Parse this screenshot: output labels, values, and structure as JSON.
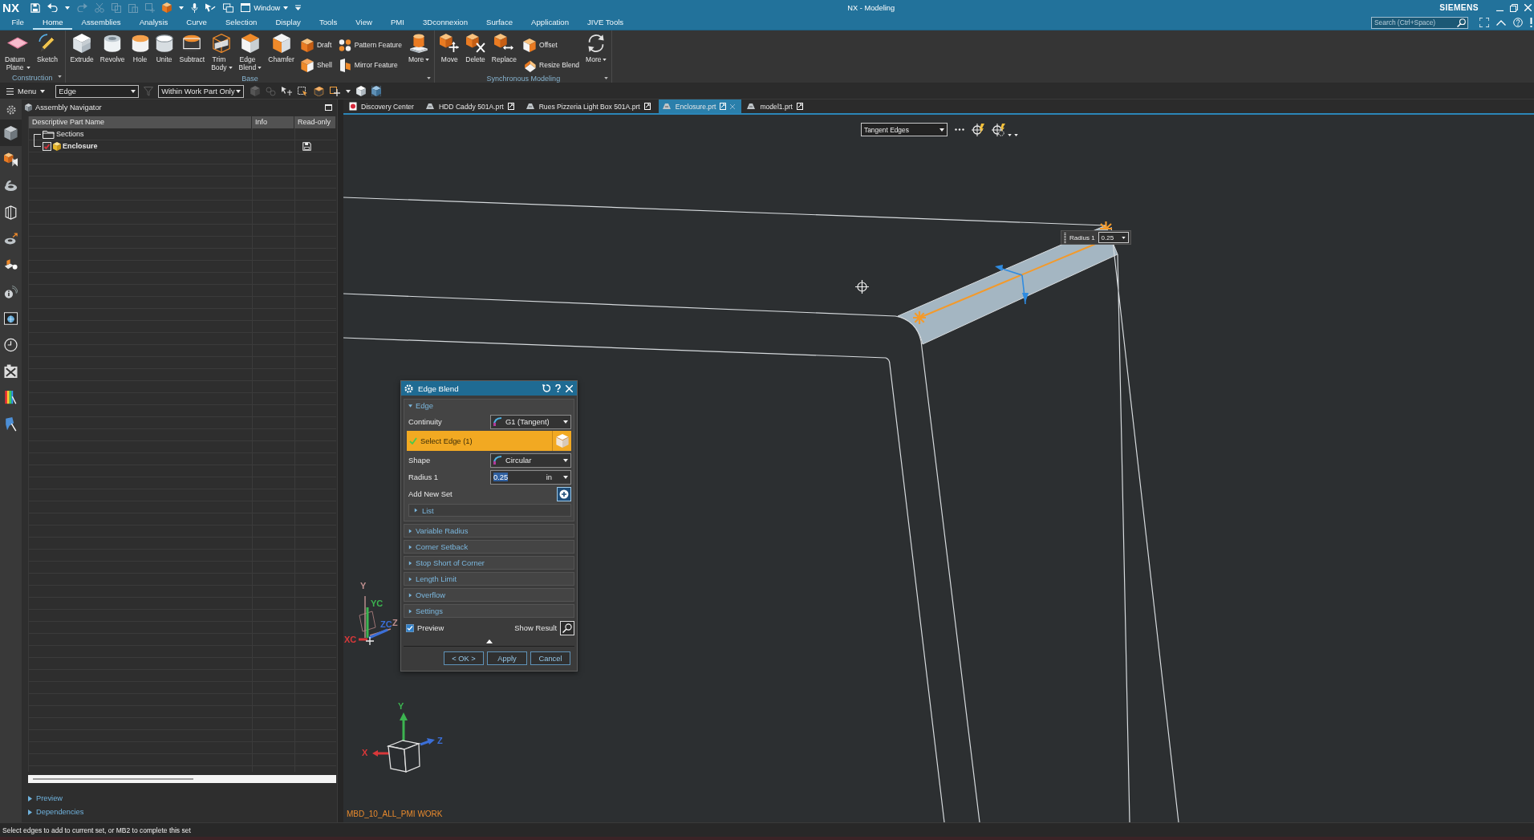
{
  "title_bar": {
    "logo": "NX",
    "window_menu": "Window",
    "title": "NX - Modeling",
    "brand": "SIEMENS",
    "search": {
      "placeholder": "Search (Ctrl+Space)"
    }
  },
  "menu_tabs": [
    {
      "label": "File",
      "selected": false
    },
    {
      "label": "Home",
      "selected": true
    },
    {
      "label": "Assemblies",
      "selected": false
    },
    {
      "label": "Analysis",
      "selected": false
    },
    {
      "label": "Curve",
      "selected": false
    },
    {
      "label": "Selection",
      "selected": false
    },
    {
      "label": "Display",
      "selected": false
    },
    {
      "label": "Tools",
      "selected": false
    },
    {
      "label": "View",
      "selected": false
    },
    {
      "label": "PMI",
      "selected": false
    },
    {
      "label": "3Dconnexion",
      "selected": false
    },
    {
      "label": "Surface",
      "selected": false
    },
    {
      "label": "Application",
      "selected": false
    },
    {
      "label": "JIVE Tools",
      "selected": false
    }
  ],
  "ribbon": {
    "groups": [
      {
        "label": "Construction",
        "items": [
          {
            "kind": "large",
            "label": "Datum Plane",
            "dropdown": true
          },
          {
            "kind": "large",
            "label": "Sketch",
            "dropdown": false
          }
        ]
      },
      {
        "label": "Base",
        "items": [
          {
            "kind": "large",
            "label": "Extrude",
            "dropdown": false
          },
          {
            "kind": "large",
            "label": "Revolve",
            "dropdown": false
          },
          {
            "kind": "large",
            "label": "Hole",
            "dropdown": false
          },
          {
            "kind": "large",
            "label": "Unite",
            "dropdown": false
          },
          {
            "kind": "large",
            "label": "Subtract",
            "dropdown": false
          },
          {
            "kind": "large",
            "label": "Trim Body",
            "dropdown": true
          },
          {
            "kind": "large",
            "label": "Edge Blend",
            "dropdown": true
          },
          {
            "kind": "large",
            "label": "Chamfer",
            "dropdown": false
          },
          {
            "kind": "stack",
            "items": [
              {
                "label": "Draft"
              },
              {
                "label": "Shell"
              }
            ]
          },
          {
            "kind": "stack",
            "items": [
              {
                "label": "Pattern Feature"
              },
              {
                "label": "Mirror Feature"
              }
            ]
          },
          {
            "kind": "large",
            "label": "More",
            "dropdown": true
          }
        ]
      },
      {
        "label": "Synchronous Modeling",
        "items": [
          {
            "kind": "large",
            "label": "Move",
            "dropdown": false
          },
          {
            "kind": "large",
            "label": "Delete",
            "dropdown": false
          },
          {
            "kind": "large",
            "label": "Replace",
            "dropdown": false
          },
          {
            "kind": "stack",
            "items": [
              {
                "label": "Offset"
              },
              {
                "label": "Resize Blend"
              }
            ]
          },
          {
            "kind": "large",
            "label": "More",
            "dropdown": true
          }
        ]
      }
    ]
  },
  "selection_bar": {
    "menu": "Menu",
    "type_filter": "Edge",
    "scope": "Within Work Part Only"
  },
  "resource_bar": [
    {
      "selected": true
    },
    {
      "selected": false
    },
    {
      "selected": false
    },
    {
      "selected": false
    },
    {
      "selected": false
    },
    {
      "selected": false
    },
    {
      "selected": false
    },
    {
      "selected": false
    },
    {
      "selected": false
    },
    {
      "selected": false
    },
    {
      "selected": false
    },
    {
      "selected": false
    }
  ],
  "assembly_navigator": {
    "title": "Assembly Navigator",
    "columns": [
      "Descriptive Part Name",
      "Info",
      "Read-only"
    ],
    "rows": [
      {
        "kind": "folder",
        "name": "Sections"
      },
      {
        "kind": "part",
        "name": "Enclosure",
        "checked": true
      }
    ],
    "panels": [
      {
        "label": "Preview",
        "expanded": false
      },
      {
        "label": "Dependencies",
        "expanded": false
      }
    ]
  },
  "document_tabs": [
    {
      "kind": "start",
      "label": "Discovery Center",
      "selected": false
    },
    {
      "kind": "part",
      "label": "HDD Caddy 501A.prt",
      "selected": false
    },
    {
      "kind": "part",
      "label": "Rues Pizzeria Light Box 501A.prt",
      "selected": false
    },
    {
      "kind": "part",
      "label": "Enclosure.prt",
      "selected": true
    },
    {
      "kind": "part",
      "label": "model1.prt",
      "selected": false
    }
  ],
  "viewport": {
    "edge_display": "Tangent Edges",
    "radius_tag": {
      "label": "Radius 1",
      "value": "0.25"
    },
    "wcs_triad": [
      {
        "label": "Y",
        "color": "#c09090"
      },
      {
        "label": "YC",
        "color": "#3cb450"
      },
      {
        "label": "ZC",
        "color": "#3b6fd8"
      },
      {
        "label": "Z",
        "color": "#c09090"
      },
      {
        "label": "XC",
        "color": "#d9383a"
      }
    ],
    "view_triad": [
      {
        "label": "Y",
        "color": "#3cb450"
      },
      {
        "label": "Z",
        "color": "#3b6fd8"
      },
      {
        "label": "X",
        "color": "#d9383a"
      }
    ],
    "work_layer": "MBD_10_ALL_PMI WORK"
  },
  "dialog": {
    "title": "Edge Blend",
    "sections": [
      {
        "label": "Edge",
        "expanded": true,
        "rows": [
          {
            "kind": "dropdown",
            "label": "Continuity",
            "value": "G1 (Tangent)"
          },
          {
            "kind": "selection",
            "label": "Select Edge (1)",
            "complete": true
          },
          {
            "kind": "dropdown",
            "label": "Shape",
            "value": "Circular"
          },
          {
            "kind": "number",
            "label": "Radius 1",
            "value": "0.25",
            "unit": "in",
            "value_selected": true
          },
          {
            "kind": "add",
            "label": "Add New Set"
          },
          {
            "kind": "group",
            "label": "List",
            "expanded": false
          }
        ]
      },
      {
        "label": "Variable Radius",
        "expanded": false
      },
      {
        "label": "Corner Setback",
        "expanded": false
      },
      {
        "label": "Stop Short of Corner",
        "expanded": false
      },
      {
        "label": "Length Limit",
        "expanded": false
      },
      {
        "label": "Overflow",
        "expanded": false
      },
      {
        "label": "Settings",
        "expanded": false
      }
    ],
    "preview": {
      "label": "Preview",
      "checked": true
    },
    "show_result": "Show Result",
    "buttons": [
      "< OK >",
      "Apply",
      "Cancel"
    ]
  },
  "status_bar": {
    "message": "Select edges to add to current set, or MB2 to complete this set"
  }
}
